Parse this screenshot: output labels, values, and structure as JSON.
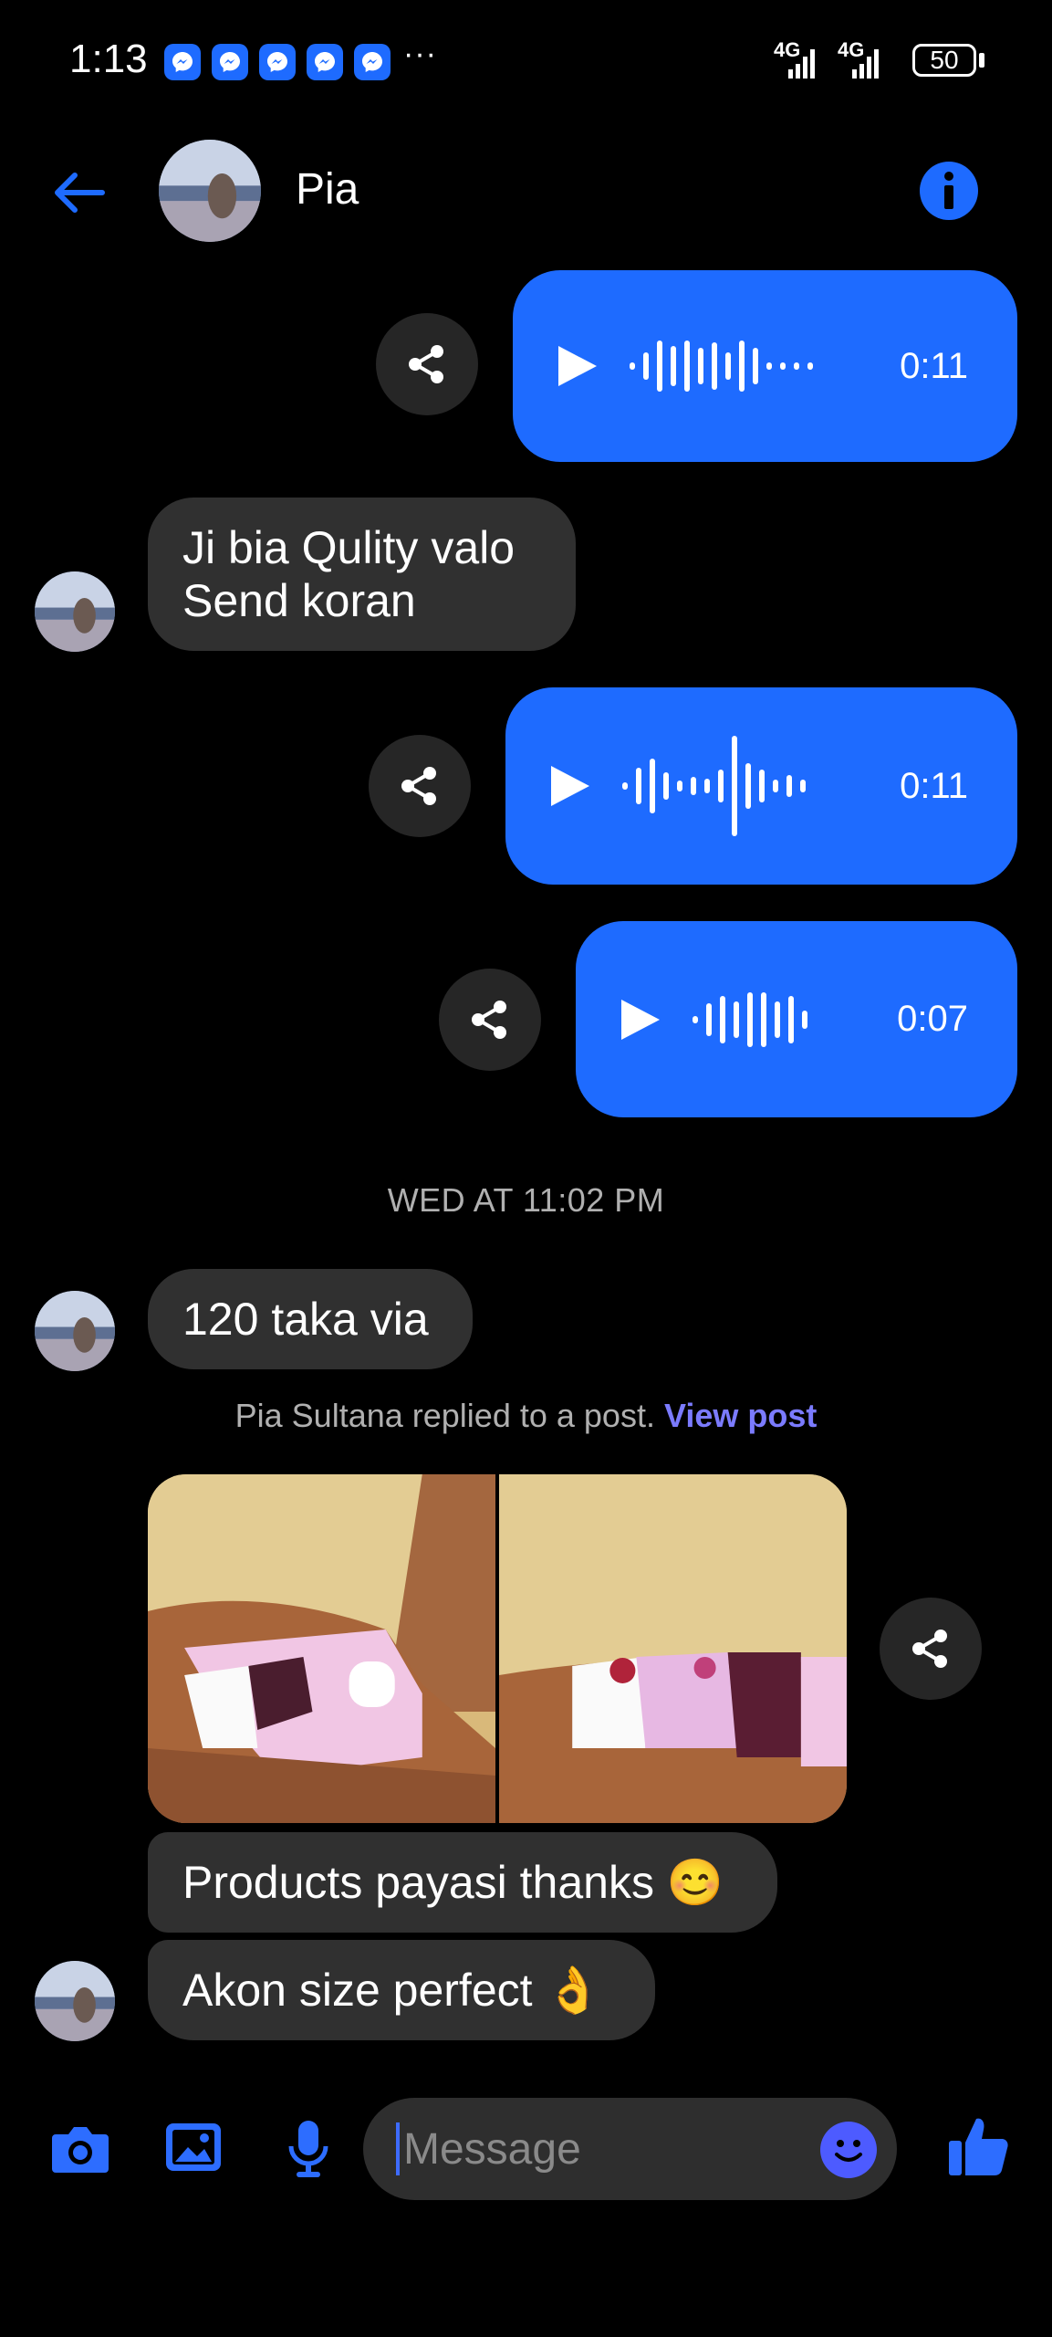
{
  "status_bar": {
    "time": "1:13",
    "more": "···",
    "network_1": "4G",
    "network_2": "4G",
    "battery": "50"
  },
  "header": {
    "contact_name": "Pia"
  },
  "messages": {
    "voice_1_duration": "0:11",
    "incoming_1_line1": "Ji bia Qulity valo",
    "incoming_1_line2": "Send koran",
    "voice_2_duration": "0:11",
    "voice_3_duration": "0:07",
    "timestamp": "WED AT 11:02 PM",
    "incoming_2": "120 taka via",
    "reply_note": "Pia Sultana replied to a post.",
    "view_post": "View post",
    "incoming_3": "Products payasi thanks 😊",
    "incoming_4": "Akon size perfect 👌"
  },
  "composer": {
    "placeholder": "Message"
  },
  "colors": {
    "accent": "#1e6bff",
    "incoming_bubble": "#303030",
    "background": "#000000"
  }
}
